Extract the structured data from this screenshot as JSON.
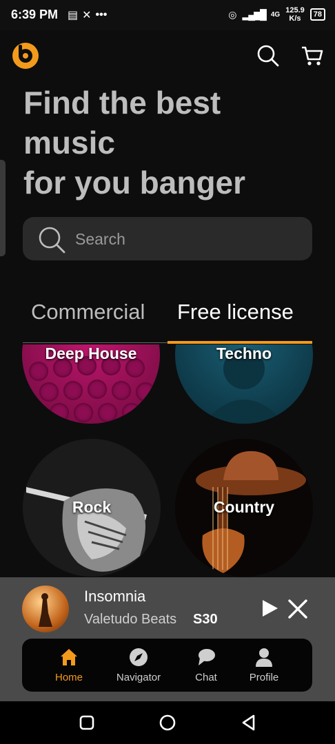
{
  "status_bar": {
    "time": "6:39 PM",
    "speed_value": "125.9",
    "speed_unit": "K/s",
    "battery": "78",
    "network": "4G"
  },
  "header": {
    "logo_icon": "brand-b-logo-icon",
    "search_icon": "search-icon",
    "cart_icon": "cart-icon",
    "headline_line1": "Find the best",
    "headline_line2": "music",
    "headline_line3": "for you banger",
    "accent_color": "#f39a1c"
  },
  "search": {
    "placeholder": "Search"
  },
  "tabs": [
    {
      "label": "Commercial",
      "active": false
    },
    {
      "label": "Free license",
      "active": true
    }
  ],
  "genres": [
    {
      "label": "Deep House"
    },
    {
      "label": "Techno"
    },
    {
      "label": "Rock"
    },
    {
      "label": "Country"
    }
  ],
  "player": {
    "title": "Insomnia",
    "artist": "Valetudo Beats",
    "price": "S30"
  },
  "bottom_nav": [
    {
      "label": "Home",
      "icon": "home-icon",
      "active": true
    },
    {
      "label": "Navigator",
      "icon": "compass-icon",
      "active": false
    },
    {
      "label": "Chat",
      "icon": "chat-icon",
      "active": false
    },
    {
      "label": "Profile",
      "icon": "profile-icon",
      "active": false
    }
  ]
}
